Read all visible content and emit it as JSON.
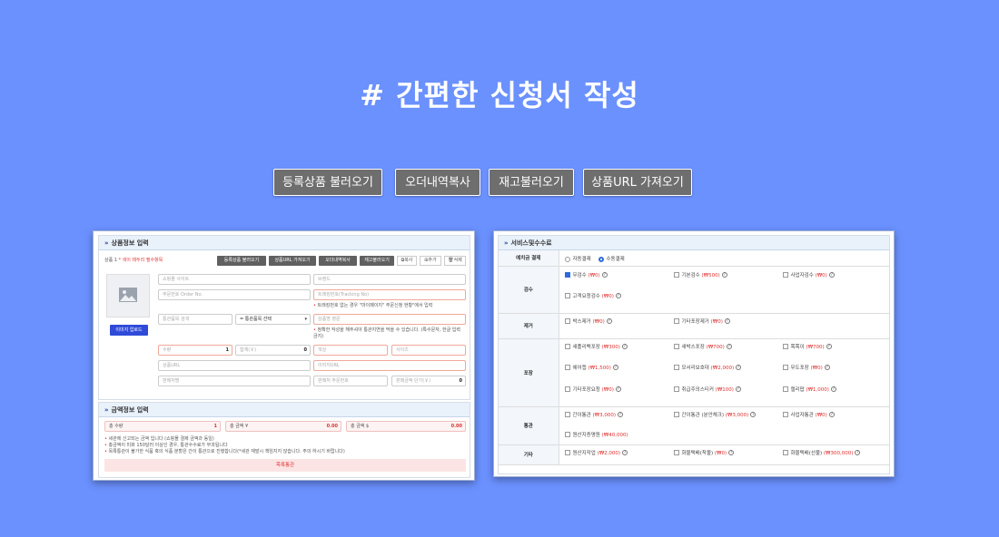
{
  "hero": {
    "title": "# 간편한 신청서 작성"
  },
  "top_buttons": [
    "등록상품 불러오기",
    "오더내역복사",
    "재고불러오기",
    "상품URL 가져오기"
  ],
  "left": {
    "product_header": "상품정보 입력",
    "product_no": "상품 1",
    "required_note": "* 색이 테두리 필수항목",
    "toolbar": [
      "등록상품 불러오기",
      "상품URL 가져오기",
      "오더내역복사",
      "재고불러오기"
    ],
    "small_buttons": [
      "복사",
      "추가",
      "삭제"
    ],
    "image_upload": "이미지 업로드",
    "fields": {
      "shopping_site": "쇼핑몰 사이트",
      "brand": "브랜드",
      "order_no": "주문번호 Order No.",
      "tracking_no": "트래킹번호(Tracking No)",
      "customs_search": "통관품목 검색",
      "customs_select": "= 통관품목 선택",
      "product_name_en": "상품명 영문",
      "qty_label": "수량",
      "qty_value": "1",
      "total_label": "합계(￥)",
      "total_value": "0",
      "color": "색상",
      "size": "사이즈",
      "product_url": "상품URL",
      "image_url": "이미지URL",
      "seller_name": "판매처명",
      "seller_order_no": "판매처 주문번호",
      "unit_price_label": "판매금액 단가(￥)",
      "unit_price_value": "0"
    },
    "note_tracking": "트래킹번호 없는 경우 \"마이페이지\" 주문신청 현황\"에서 입력",
    "note_name": "정확한 작성을 해주셔야 통관지연을 막을 수 있습니다. (특수문자, 한글 입력 금지)",
    "amount_header": "금액정보 입력",
    "amount_fields": [
      {
        "label": "총 수량",
        "value": "1"
      },
      {
        "label": "총 금액 ¥",
        "value": "0.00"
      },
      {
        "label": "총 금액 $",
        "value": "0.00"
      }
    ],
    "amount_notes": [
      "세관에 신고되는 금액 입니다 (쇼핑몰 결제 금액과 동일)",
      "총금액이 미화 150달러 이상인 경우, 통관수수료가 부과됩니다",
      "목록통관이 불가한 식품 혹의 식품 분할은 간이 통관으로 진행합니다(*세관 재발시 책임지지 않습니다. 주의 하시기 바랍니다)"
    ],
    "customs_bar": "목록통관"
  },
  "right": {
    "header": "서비스및수수료",
    "rows": [
      {
        "label": "예치금 결제",
        "options": [
          {
            "text": "자동결제",
            "type": "radio",
            "on": false
          },
          {
            "text": "수동결제",
            "type": "radio",
            "on": true
          }
        ]
      },
      {
        "label": "검수",
        "options": [
          {
            "text": "무검수",
            "price": "(₩0)",
            "on": true
          },
          {
            "text": "기본검수",
            "price": "(₩500)",
            "on": false
          },
          {
            "text": "사업자검수",
            "price": "(₩0)",
            "on": false
          },
          {
            "text": "고객요청검수",
            "price": "(₩0)",
            "on": false
          }
        ]
      },
      {
        "label": "제거",
        "options": [
          {
            "text": "박스제거",
            "price": "(₩0)",
            "on": false
          },
          {
            "text": "기타포장제거",
            "price": "(₩0)",
            "on": false
          }
        ]
      },
      {
        "label": "포장",
        "options": [
          {
            "text": "새플리백포장",
            "price": "(₩300)",
            "on": false
          },
          {
            "text": "새박스포장",
            "price": "(₩700)",
            "on": false
          },
          {
            "text": "뽁뽁이",
            "price": "(₩700)",
            "on": false
          },
          {
            "text": "에어캡",
            "price": "(₩1,500)",
            "on": false
          },
          {
            "text": "모서리보호대",
            "price": "(₩2,000)",
            "on": false
          },
          {
            "text": "무도포장",
            "price": "(₩0)",
            "on": false
          },
          {
            "text": "기타포장요청",
            "price": "(₩0)",
            "on": false
          },
          {
            "text": "취급주의스티커",
            "price": "(₩100)",
            "on": false
          },
          {
            "text": "캘리팝",
            "price": "(₩1,000)",
            "on": false
          }
        ]
      },
      {
        "label": "통관",
        "options": [
          {
            "text": "간이통관",
            "price": "(₩3,000)",
            "on": false
          },
          {
            "text": "간이통관 (분안체크)",
            "price": "(₩3,000)",
            "on": false
          },
          {
            "text": "사업자통관",
            "price": "(₩0)",
            "on": false
          },
          {
            "text": "원산지증명원",
            "price": "(₩40,000)",
            "on": false
          }
        ]
      },
      {
        "label": "기타",
        "options": [
          {
            "text": "원산지작업",
            "price": "(₩2,000)",
            "on": false
          },
          {
            "text": "화물택배(착불)",
            "price": "(₩0)",
            "on": false
          },
          {
            "text": "화물택배(선불)",
            "price": "(₩300,000)",
            "on": false
          }
        ]
      }
    ]
  },
  "colors": {
    "background": "#6b91ff",
    "button": "#6e6e6e",
    "accent": "#2f6bdb",
    "price": "#e03030"
  }
}
